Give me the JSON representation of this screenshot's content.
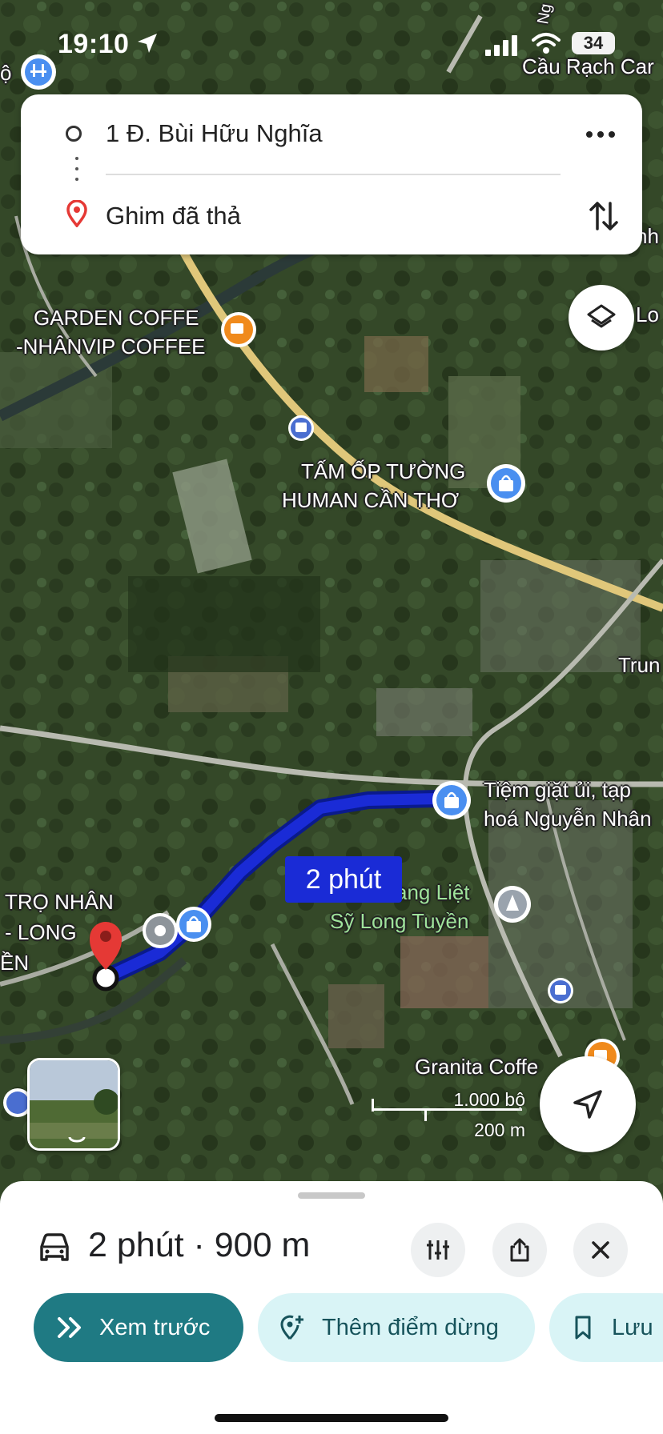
{
  "status_bar": {
    "time": "19:10",
    "battery": "34"
  },
  "directions": {
    "origin": "1 Đ. Bùi Hữu Nghĩa",
    "destination": "Ghim đã thả"
  },
  "map": {
    "pois": [
      {
        "name": "Cầu Rạch Car",
        "kind": "bridge"
      },
      {
        "name": "GARDEN COFFE",
        "kind": "cafe"
      },
      {
        "name": "-NHÂNVIP COFFEE",
        "kind": "cafe"
      },
      {
        "name": "TẤM ỐP TƯỜNG",
        "kind": "shopping"
      },
      {
        "name": "HUMAN CẦN THƠ",
        "kind": "shopping"
      },
      {
        "name": "Tiệm giặt ủi, tạp",
        "kind": "shopping"
      },
      {
        "name": "hoá Nguyễn Nhân",
        "kind": "shopping"
      },
      {
        "name": "ang Liệt",
        "kind": "monument"
      },
      {
        "name": "Sỹ Long Tuyền",
        "kind": "monument"
      },
      {
        "name": "TRỌ NHÂN",
        "kind": "lodging"
      },
      {
        "name": "- LONG",
        "kind": "lodging"
      },
      {
        "name": "ỀN",
        "kind": "lodging"
      },
      {
        "name": "Granita Coffe",
        "kind": "cafe"
      },
      {
        "name": "Lo",
        "kind": "partial"
      },
      {
        "name": "nh",
        "kind": "partial"
      },
      {
        "name": "Trun",
        "kind": "partial"
      },
      {
        "name": "Ng",
        "kind": "partial"
      },
      {
        "name": "ộ",
        "kind": "partial"
      }
    ],
    "route_duration_label": "2 phút",
    "scale": {
      "imperial": "1.000 bộ",
      "metric": "200 m"
    }
  },
  "trip": {
    "summary": "2 phút · 900 m",
    "actions": {
      "preview": "Xem trước",
      "add_stop": "Thêm điểm dừng",
      "save": "Lưu"
    }
  },
  "colors": {
    "route": "#1a2bd6",
    "primary_chip": "#1f7a83",
    "light_chip": "#d9f4f6",
    "pin": "#e53935",
    "poi_blue": "#4a8ff0",
    "poi_orange": "#f08a1c"
  },
  "icons": [
    "location-arrow-icon",
    "signal-icon",
    "wifi-icon",
    "origin-circle-icon",
    "destination-pin-icon",
    "more-options-icon",
    "swap-icon",
    "layers-icon",
    "recenter-arrow-icon",
    "car-icon",
    "route-options-icon",
    "share-icon",
    "close-icon",
    "preview-chevrons-icon",
    "add-stop-icon",
    "bookmark-icon"
  ]
}
